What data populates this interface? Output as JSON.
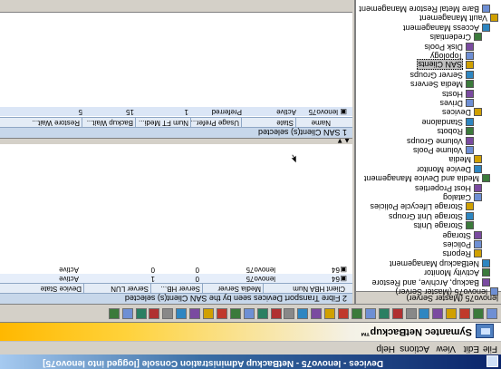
{
  "window": {
    "title": "Devices - lenovo75 - NetBackup Administration Console [logged into lenovo75]"
  },
  "menu": [
    "File",
    "Edit",
    "View",
    "Actions",
    "Help"
  ],
  "brand": "Symantec NetBackup™",
  "toolbar_icons": [
    "new-icon",
    "open-icon",
    "save-icon",
    "refresh-icon",
    "print-icon",
    "find-icon",
    "filter-icon",
    "properties-icon",
    "help-icon",
    "back-icon",
    "forward-icon",
    "delete-icon",
    "run-icon",
    "stop-icon",
    "config-icon",
    "tools-icon",
    "options-icon",
    "config-icon-2",
    "wizard-icon",
    "device-icon",
    "scan-icon",
    "disk-icon",
    "tape-icon",
    "library-icon",
    "drive-icon",
    "volume-icon",
    "pool-icon",
    "check-icon",
    "flag-icon"
  ],
  "tree": {
    "header": "lenovo75 (Master Server)",
    "items": [
      {
        "label": "Bare Metal Restore Management",
        "indent": 1
      },
      {
        "label": "Vault Management",
        "indent": 0
      },
      {
        "label": "Access Management",
        "indent": 1
      },
      {
        "label": "Credentials",
        "indent": 2
      },
      {
        "label": "Disk Pools",
        "indent": 3
      },
      {
        "label": "Topology",
        "indent": 3
      },
      {
        "label": "SAN Clients",
        "indent": 3,
        "selected": true
      },
      {
        "label": "Server Groups",
        "indent": 3
      },
      {
        "label": "Media Servers",
        "indent": 3
      },
      {
        "label": "Hosts",
        "indent": 3
      },
      {
        "label": "Drives",
        "indent": 3
      },
      {
        "label": "Devices",
        "indent": 2
      },
      {
        "label": "Standalone",
        "indent": 3
      },
      {
        "label": "Robots",
        "indent": 3
      },
      {
        "label": "Volume Groups",
        "indent": 3
      },
      {
        "label": "Volume Pools",
        "indent": 3
      },
      {
        "label": "Media",
        "indent": 2
      },
      {
        "label": "Device Monitor",
        "indent": 2
      },
      {
        "label": "Media and Device Management",
        "indent": 1
      },
      {
        "label": "Host Properties",
        "indent": 2
      },
      {
        "label": "Catalog",
        "indent": 2
      },
      {
        "label": "Storage Lifecycle Policies",
        "indent": 3
      },
      {
        "label": "Storage Unit Groups",
        "indent": 3
      },
      {
        "label": "Storage Units",
        "indent": 3
      },
      {
        "label": "Storage",
        "indent": 2
      },
      {
        "label": "Policies",
        "indent": 2
      },
      {
        "label": "Reports",
        "indent": 2
      },
      {
        "label": "NetBackup Management",
        "indent": 1
      },
      {
        "label": "Activity Monitor",
        "indent": 1
      },
      {
        "label": "Backup, Archive, and Restore",
        "indent": 1
      },
      {
        "label": "lenovo75 (Master Server)",
        "indent": 0
      }
    ]
  },
  "top_pane": {
    "header": "2 Fibre Transport Devices seen by the SAN Client(s) selected",
    "columns": [
      "Client HBA Num",
      "Media Server",
      "Server HB...",
      "Server LUN",
      "Device State"
    ],
    "rows": [
      [
        "64",
        "lenovo75",
        "0",
        "1",
        "Active"
      ],
      [
        "64",
        "lenovo75",
        "0",
        "0",
        "Active"
      ]
    ]
  },
  "bottom_pane": {
    "header": "1 SAN Client(s) selected",
    "columns": [
      "Name",
      "State",
      "Usage Prefer...",
      "Num FT Medi...",
      "Backup Wait...",
      "Restore Wait..."
    ],
    "rows": [
      [
        "lenovo75",
        "Active",
        "Preferred",
        "1",
        "15",
        "5"
      ]
    ]
  },
  "colors": {
    "title_start": "#0a246a",
    "accent_yellow": "#ffd23a",
    "selection": "#c0c0c0",
    "header_blue": "#c7d7ea"
  }
}
